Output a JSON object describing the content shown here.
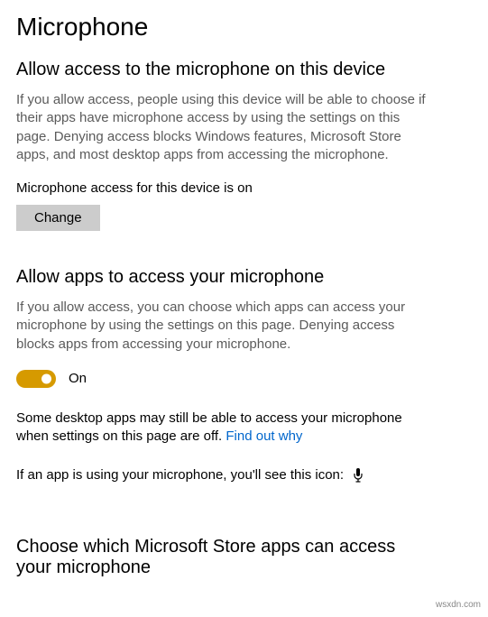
{
  "page": {
    "title": "Microphone"
  },
  "section1": {
    "header": "Allow access to the microphone on this device",
    "description": "If you allow access, people using this device will be able to choose if their apps have microphone access by using the settings on this page. Denying access blocks Windows features, Microsoft Store apps, and most desktop apps from accessing the microphone.",
    "status": "Microphone access for this device is on",
    "change_button": "Change"
  },
  "section2": {
    "header": "Allow apps to access your microphone",
    "description": "If you allow access, you can choose which apps can access your microphone by using the settings on this page. Denying access blocks apps from accessing your microphone.",
    "toggle_state": "On",
    "desktop_note_prefix": "Some desktop apps may still be able to access your microphone when settings on this page are off. ",
    "find_out_link": "Find out why",
    "icon_line": "If an app is using your microphone, you'll see this icon:",
    "icon_name": "microphone-icon"
  },
  "section3": {
    "header": "Choose which Microsoft Store apps can access your microphone"
  },
  "watermark": "wsxdn.com"
}
